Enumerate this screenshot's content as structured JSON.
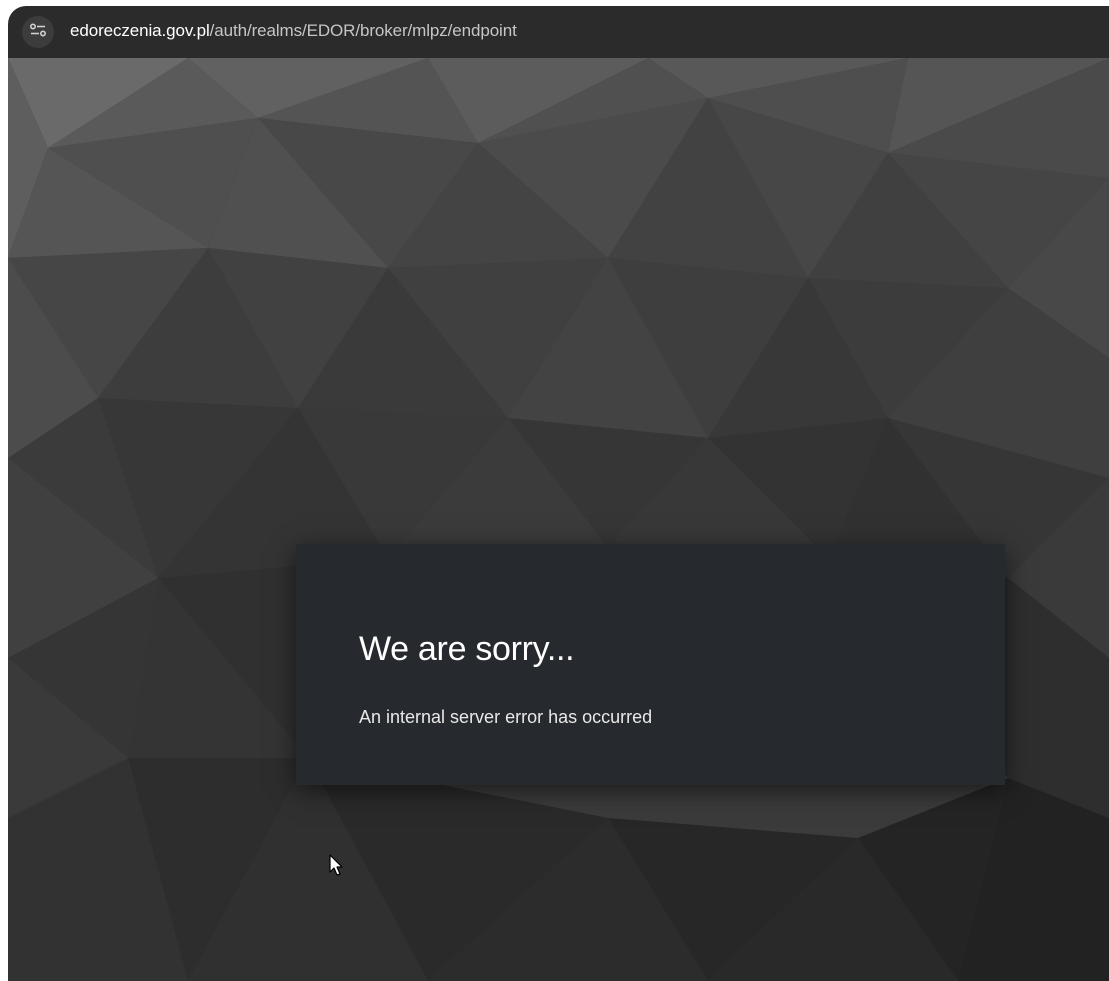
{
  "browser": {
    "url_domain": "edoreczenia.gov.pl",
    "url_path": "/auth/realms/EDOR/broker/mlpz/endpoint",
    "site_info_icon": "tune-icon"
  },
  "error": {
    "title": "We are sorry...",
    "message": "An internal server error has occurred"
  },
  "colors": {
    "address_bar_bg": "#2b2b2b",
    "page_bg": "#3a3a3a",
    "card_bg": "#26292d",
    "title_text": "#ffffff"
  }
}
